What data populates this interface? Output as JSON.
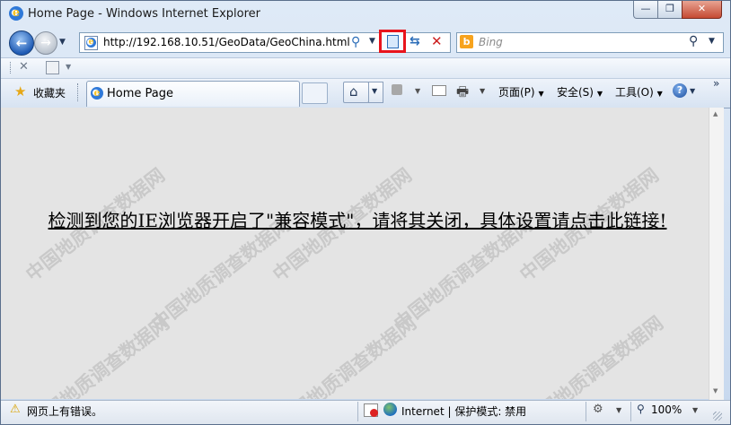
{
  "window": {
    "title": "Home Page - Windows Internet Explorer",
    "minimize_glyph": "—",
    "restore_glyph": "❐",
    "close_glyph": "✕"
  },
  "address_bar": {
    "url": "http://192.168.10.51/GeoData/GeoChina.html"
  },
  "search": {
    "placeholder": "Bing"
  },
  "favorites": {
    "label": "收藏夹"
  },
  "tab": {
    "label": "Home Page"
  },
  "command_bar": {
    "page_label": "页面(P)",
    "safety_label": "安全(S)",
    "tools_label": "工具(O)",
    "more_glyph": "»"
  },
  "content": {
    "message": "检测到您的IE浏览器开启了\"兼容模式\"，请将其关闭，具体设置请点击此链接!",
    "watermark": "中国地质调查数据网"
  },
  "status_bar": {
    "error_text": "网页上有错误。",
    "zone_text": "Internet | 保护模式: 禁用",
    "zoom": "100%"
  },
  "colors": {
    "highlight_box": "#e8141c",
    "content_bg": "#e4e4e4",
    "watermark": "#c9c9c9"
  },
  "icons": [
    "ie-logo-icon",
    "back-arrow-icon",
    "forward-arrow-icon",
    "page-icon",
    "compat-view-icon",
    "refresh-icon",
    "stop-icon",
    "bing-icon",
    "search-magnifier-icon",
    "close-x-icon",
    "home-icon",
    "rss-feed-icon",
    "mail-icon",
    "printer-icon",
    "help-icon",
    "warning-icon",
    "globe-icon",
    "zoom-icon",
    "star-icon"
  ]
}
